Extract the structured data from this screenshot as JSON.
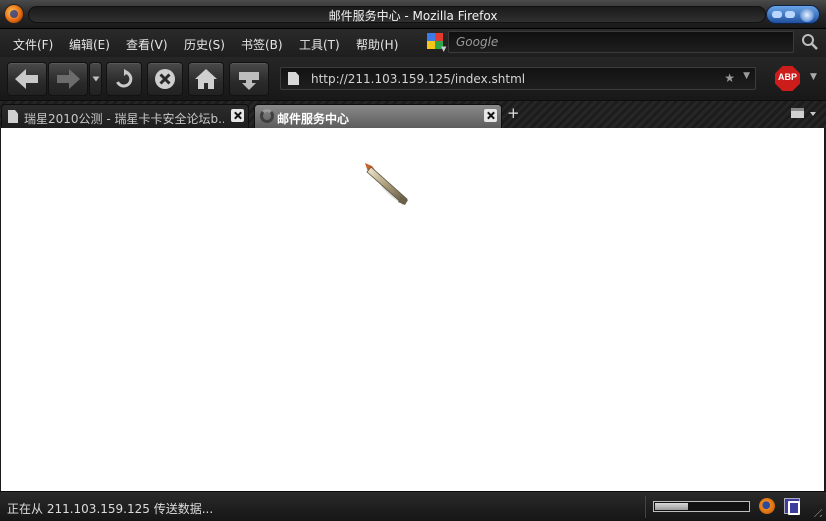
{
  "window": {
    "title": "邮件服务中心 - Mozilla Firefox"
  },
  "menu": {
    "items": [
      {
        "label": "文件(F)"
      },
      {
        "label": "编辑(E)"
      },
      {
        "label": "查看(V)"
      },
      {
        "label": "历史(S)"
      },
      {
        "label": "书签(B)"
      },
      {
        "label": "工具(T)"
      },
      {
        "label": "帮助(H)"
      }
    ]
  },
  "search": {
    "engine_icon": "google-icon",
    "placeholder": "Google"
  },
  "navigation": {
    "buttons": [
      "back-icon",
      "forward-icon",
      "reload-icon",
      "stop-icon",
      "home-icon",
      "download-icon"
    ],
    "url": "http://211.103.159.125/index.shtml"
  },
  "tabs": [
    {
      "title": "瑞星2010公测 - 瑞星卡卡安全论坛b...",
      "active": false
    },
    {
      "title": "邮件服务中心",
      "active": true
    }
  ],
  "status": {
    "text": "正在从 211.103.159.125 传送数据...",
    "progress": 0.35
  },
  "colors": {
    "chrome_dark": "#1b1b1b",
    "active_tab": "#6e6e6e",
    "abp_red": "#cc1c1c",
    "content_bg": "#ffffff"
  }
}
